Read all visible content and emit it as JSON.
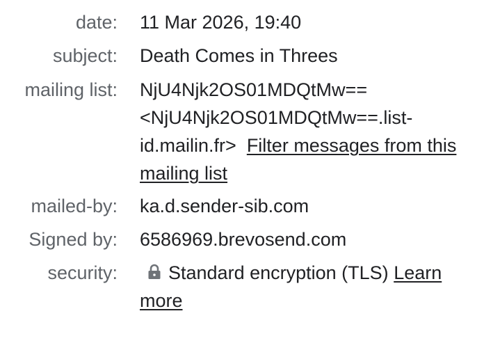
{
  "details": {
    "date": {
      "label": "date:",
      "value": "11 Mar 2026, 19:40"
    },
    "subject": {
      "label": "subject:",
      "value": "Death Comes in Threes"
    },
    "mailing_list": {
      "label": "mailing list:",
      "line1": "NjU4Njk2OS01MDQtMw==",
      "line2": "<NjU4Njk2OS01MDQtMw==.list-",
      "line3": "id.mailin.fr>",
      "filter_link_part1": "Filter messages from this",
      "filter_link_part2": "mailing list"
    },
    "mailed_by": {
      "label": "mailed-by:",
      "value": "ka.d.sender-sib.com"
    },
    "signed_by": {
      "label": "Signed by:",
      "value": "6586969.brevosend.com"
    },
    "security": {
      "label": "security:",
      "icon": "lock-icon",
      "value": "Standard encryption (TLS)",
      "learn_link_part1": "Learn",
      "learn_link_part2": "more"
    }
  }
}
